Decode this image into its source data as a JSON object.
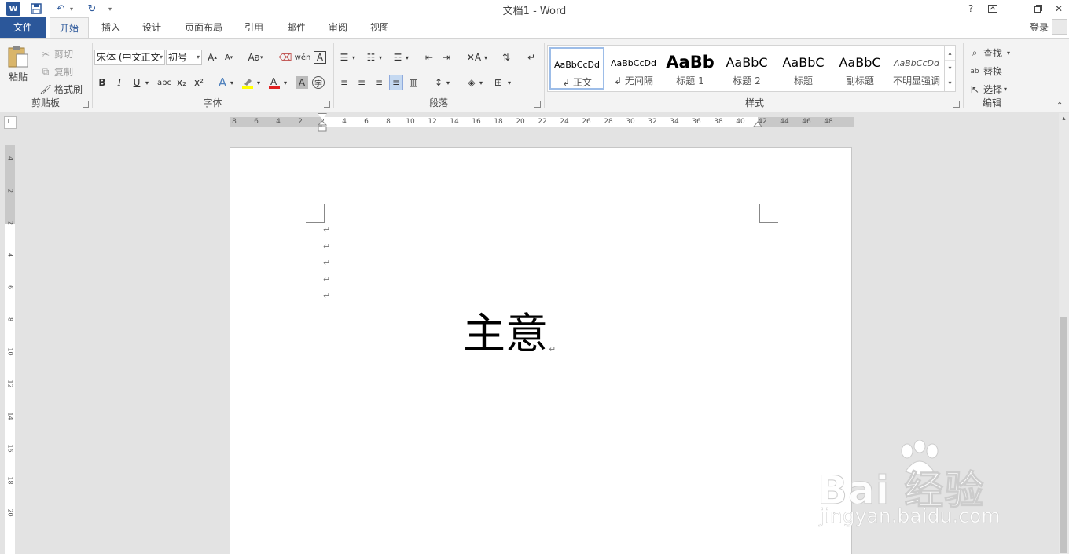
{
  "window": {
    "title": "文档1 - Word",
    "help": "?",
    "login": "登录"
  },
  "tabs": [
    {
      "label": "文件"
    },
    {
      "label": "开始"
    },
    {
      "label": "插入"
    },
    {
      "label": "设计"
    },
    {
      "label": "页面布局"
    },
    {
      "label": "引用"
    },
    {
      "label": "邮件"
    },
    {
      "label": "审阅"
    },
    {
      "label": "视图"
    }
  ],
  "clipboard": {
    "paste": "粘贴",
    "cut": "剪切",
    "copy": "复制",
    "format_painter": "格式刷",
    "group_label": "剪贴板"
  },
  "font": {
    "font_name": "宋体 (中文正文",
    "font_size": "初号",
    "grow": "A",
    "shrink": "A",
    "change_case": "Aa",
    "bold": "B",
    "italic": "I",
    "underline": "U",
    "strike": "abc",
    "subscript": "x₂",
    "superscript": "x²",
    "group_label": "字体"
  },
  "paragraph": {
    "group_label": "段落"
  },
  "styles": {
    "items": [
      {
        "preview": "AaBbCcDd",
        "name": "↲ 正文"
      },
      {
        "preview": "AaBbCcDd",
        "name": "↲ 无间隔"
      },
      {
        "preview": "AaBb",
        "name": "标题 1"
      },
      {
        "preview": "AaBbC",
        "name": "标题 2"
      },
      {
        "preview": "AaBbC",
        "name": "标题"
      },
      {
        "preview": "AaBbC",
        "name": "副标题"
      },
      {
        "preview": "AaBbCcDd",
        "name": "不明显强调"
      }
    ],
    "group_label": "样式"
  },
  "editing": {
    "find": "查找",
    "replace": "替换",
    "select": "选择",
    "group_label": "编辑"
  },
  "ruler": {
    "labels": [
      "8",
      "6",
      "4",
      "2",
      "2",
      "4",
      "6",
      "8",
      "10",
      "12",
      "14",
      "16",
      "18",
      "20",
      "22",
      "24",
      "26",
      "28",
      "30",
      "32",
      "34",
      "36",
      "38",
      "40",
      "42",
      "44",
      "46",
      "48"
    ],
    "vlabels": [
      "4",
      "2",
      "2",
      "4",
      "6",
      "8",
      "10",
      "12",
      "14",
      "16",
      "18",
      "20"
    ]
  },
  "document": {
    "paragraph_mark": "↵",
    "body_text": "主意"
  },
  "watermark": {
    "brand": "Bai 经验",
    "url": "jingyan.baidu.com"
  }
}
